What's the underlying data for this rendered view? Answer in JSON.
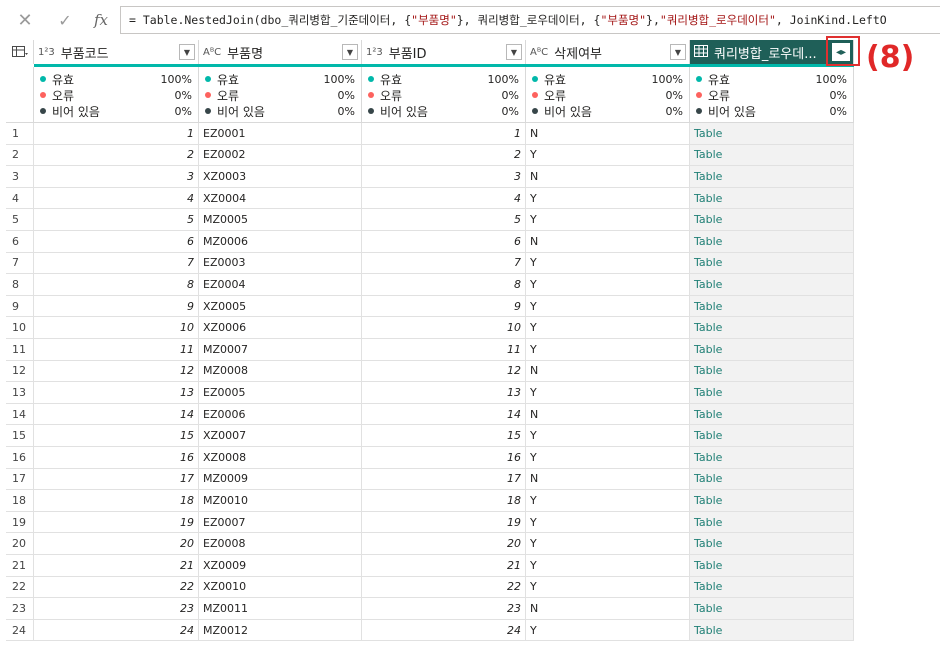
{
  "formula_bar": {
    "cancel_icon": "close-icon",
    "commit_icon": "checkmark-icon",
    "fx_label": "fx",
    "formula_parts": [
      {
        "t": "= Table.NestedJoin(dbo_쿼리병합_기준데이터, {",
        "s": false
      },
      {
        "t": "\"부품명\"",
        "s": true
      },
      {
        "t": "}, 쿼리병합_로우데이터, {",
        "s": false
      },
      {
        "t": "\"부품명\"",
        "s": true
      },
      {
        "t": "}, ",
        "s": false
      },
      {
        "t": "\"쿼리병합_로우데이터\"",
        "s": true
      },
      {
        "t": ", JoinKind.LeftO",
        "s": false
      }
    ]
  },
  "table_menu_icon": "table-menu-icon",
  "columns": [
    {
      "type": "1²3",
      "name": "부품코드"
    },
    {
      "type": "AᴮC",
      "name": "부품명"
    },
    {
      "type": "1²3",
      "name": "부품ID"
    },
    {
      "type": "AᴮC",
      "name": "삭제여부"
    },
    {
      "type": "table",
      "name": "쿼리병합_로우데..."
    }
  ],
  "quality": {
    "valid_label": "유효",
    "error_label": "오류",
    "empty_label": "비어 있음",
    "valid_pct": "100%",
    "error_pct": "0%",
    "empty_pct": "0%",
    "colors": {
      "valid": "#01b8aa",
      "error": "#fd625e",
      "empty": "#374649"
    }
  },
  "rows": [
    [
      "1",
      "1",
      "EZ0001",
      "1",
      "N",
      "Table"
    ],
    [
      "2",
      "2",
      "EZ0002",
      "2",
      "Y",
      "Table"
    ],
    [
      "3",
      "3",
      "XZ0003",
      "3",
      "N",
      "Table"
    ],
    [
      "4",
      "4",
      "XZ0004",
      "4",
      "Y",
      "Table"
    ],
    [
      "5",
      "5",
      "MZ0005",
      "5",
      "Y",
      "Table"
    ],
    [
      "6",
      "6",
      "MZ0006",
      "6",
      "N",
      "Table"
    ],
    [
      "7",
      "7",
      "EZ0003",
      "7",
      "Y",
      "Table"
    ],
    [
      "8",
      "8",
      "EZ0004",
      "8",
      "Y",
      "Table"
    ],
    [
      "9",
      "9",
      "XZ0005",
      "9",
      "Y",
      "Table"
    ],
    [
      "10",
      "10",
      "XZ0006",
      "10",
      "Y",
      "Table"
    ],
    [
      "11",
      "11",
      "MZ0007",
      "11",
      "Y",
      "Table"
    ],
    [
      "12",
      "12",
      "MZ0008",
      "12",
      "N",
      "Table"
    ],
    [
      "13",
      "13",
      "EZ0005",
      "13",
      "Y",
      "Table"
    ],
    [
      "14",
      "14",
      "EZ0006",
      "14",
      "N",
      "Table"
    ],
    [
      "15",
      "15",
      "XZ0007",
      "15",
      "Y",
      "Table"
    ],
    [
      "16",
      "16",
      "XZ0008",
      "16",
      "Y",
      "Table"
    ],
    [
      "17",
      "17",
      "MZ0009",
      "17",
      "N",
      "Table"
    ],
    [
      "18",
      "18",
      "MZ0010",
      "18",
      "Y",
      "Table"
    ],
    [
      "19",
      "19",
      "EZ0007",
      "19",
      "Y",
      "Table"
    ],
    [
      "20",
      "20",
      "EZ0008",
      "20",
      "Y",
      "Table"
    ],
    [
      "21",
      "21",
      "XZ0009",
      "21",
      "Y",
      "Table"
    ],
    [
      "22",
      "22",
      "XZ0010",
      "22",
      "Y",
      "Table"
    ],
    [
      "23",
      "23",
      "MZ0011",
      "23",
      "N",
      "Table"
    ],
    [
      "24",
      "24",
      "MZ0012",
      "24",
      "Y",
      "Table"
    ]
  ],
  "expand_icon": "expand-column-icon",
  "annotation": "(8)"
}
